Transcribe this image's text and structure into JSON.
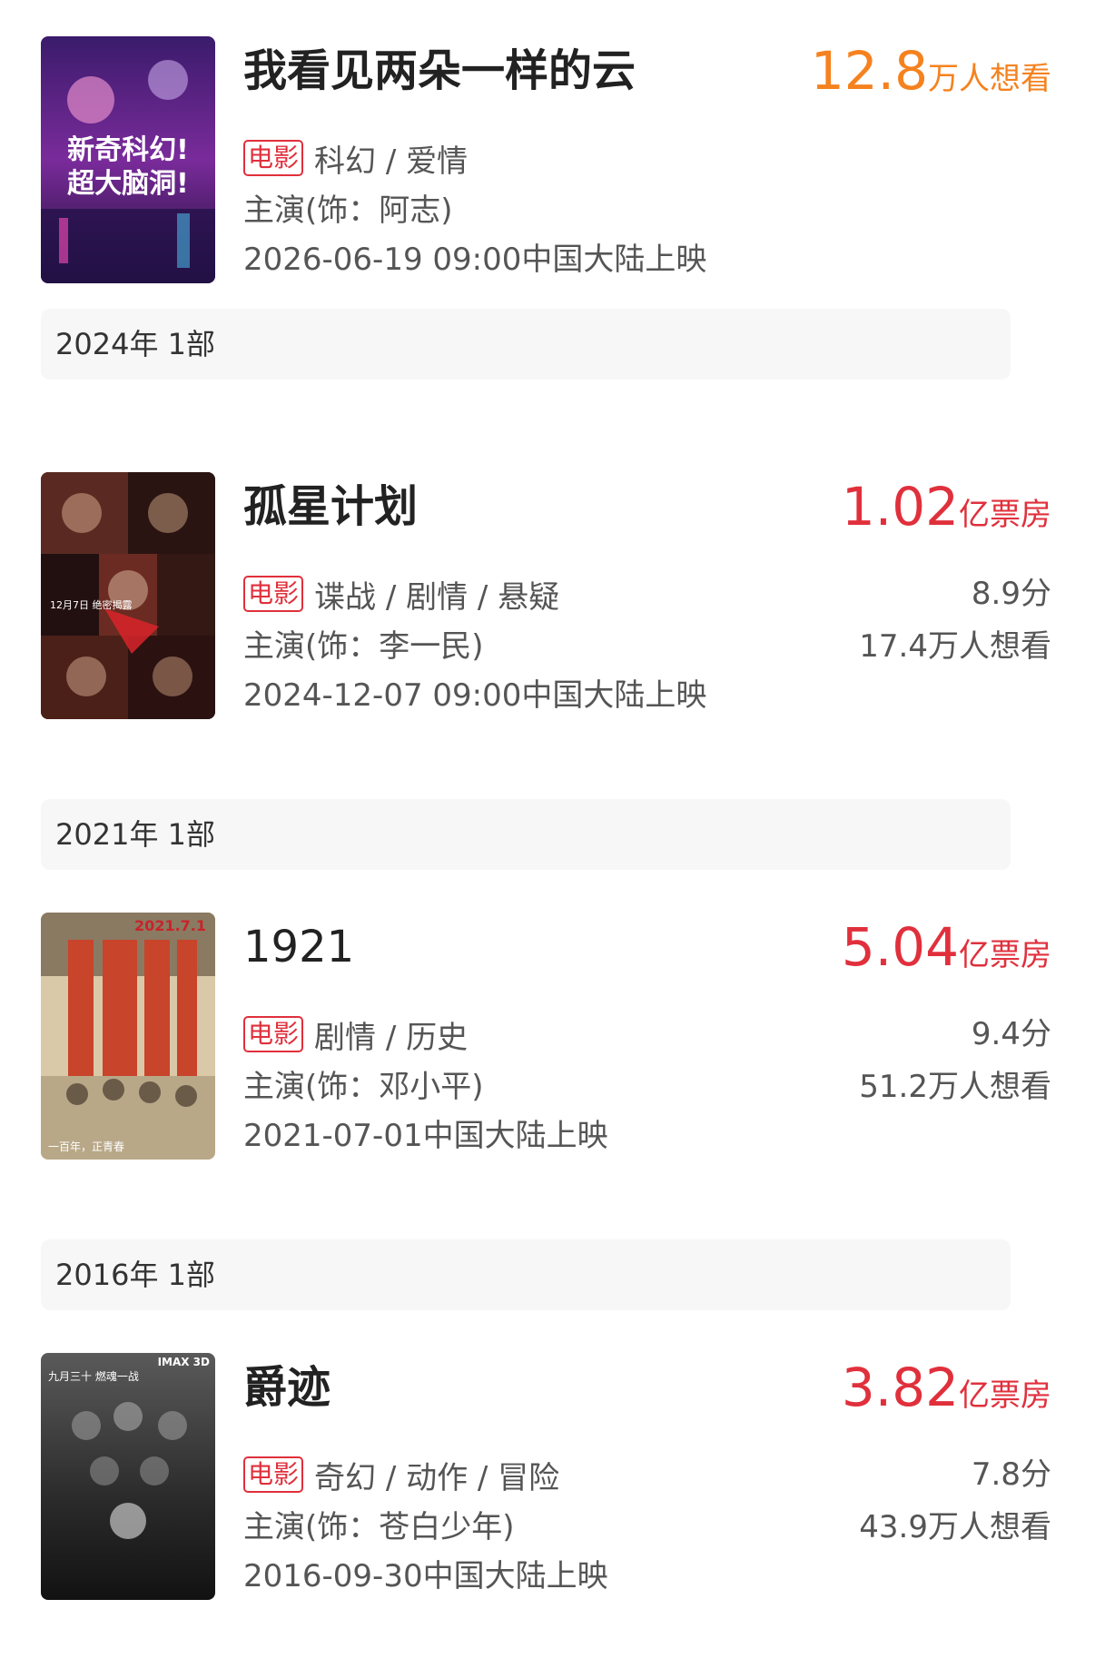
{
  "colors": {
    "badge": "#e0303c",
    "box_office": "#e0303c",
    "want_to_see": "#f5821f",
    "section_bg": "#f7f7f7"
  },
  "movies": [
    {
      "title": "我看见两朵一样的云",
      "metric_value": "12.8",
      "metric_unit": "万人想看",
      "badge": "电影",
      "genre": "科幻 / 爱情",
      "cast": "主演(饰：阿志)",
      "release": "2026-06-19 09:00中国大陆上映",
      "poster_text": [
        "新奇科幻!",
        "超大脑洞!"
      ]
    },
    {
      "title": "孤星计划",
      "metric_value": "1.02",
      "metric_unit": "亿票房",
      "badge": "电影",
      "genre": "谍战 / 剧情 / 悬疑",
      "cast": "主演(饰：李一民)",
      "release": "2024-12-07 09:00中国大陆上映",
      "score": "8.9分",
      "wish": "17.4万人想看",
      "poster_text": [
        "12月7日 绝密揭露"
      ]
    },
    {
      "title": "1921",
      "metric_value": "5.04",
      "metric_unit": "亿票房",
      "badge": "电影",
      "genre": "剧情 / 历史",
      "cast": "主演(饰：邓小平)",
      "release": "2021-07-01中国大陆上映",
      "score": "9.4分",
      "wish": "51.2万人想看",
      "poster_text": [
        "2021.7.1",
        "一百年，正青春"
      ]
    },
    {
      "title": "爵迹",
      "metric_value": "3.82",
      "metric_unit": "亿票房",
      "badge": "电影",
      "genre": "奇幻 / 动作 / 冒险",
      "cast": "主演(饰：苍白少年)",
      "release": "2016-09-30中国大陆上映",
      "score": "7.8分",
      "wish": "43.9万人想看",
      "poster_text": [
        "IMAX 3D",
        "九月三十 燃魂一战"
      ]
    }
  ],
  "years": [
    {
      "label": "2024年  1部"
    },
    {
      "label": "2021年  1部"
    },
    {
      "label": "2016年  1部"
    }
  ]
}
